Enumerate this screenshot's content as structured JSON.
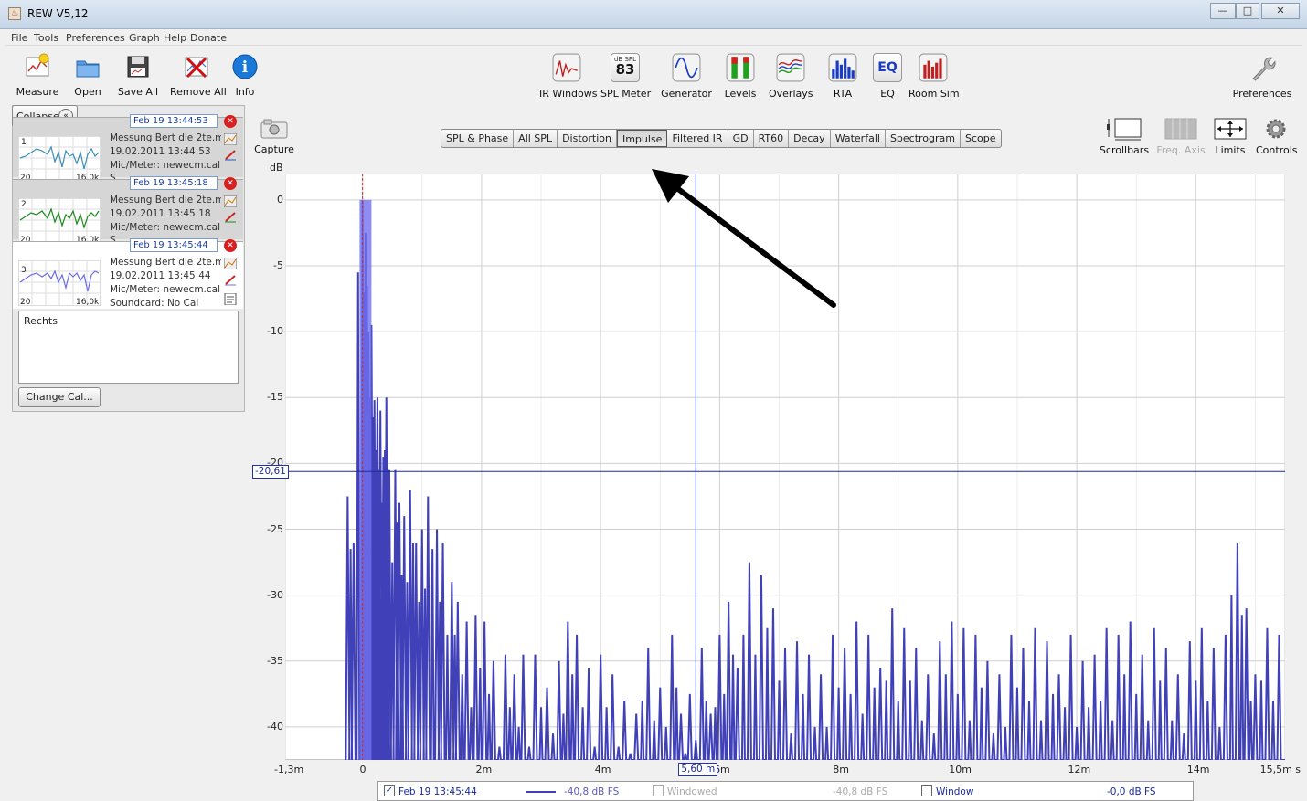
{
  "window": {
    "title": "REW V5,12",
    "min": "—",
    "max": "□",
    "close": "✕"
  },
  "menu": [
    "File",
    "Tools",
    "Preferences",
    "Graph",
    "Help",
    "Donate"
  ],
  "toolbar_left": [
    {
      "label": "Measure",
      "icon": "measure-icon"
    },
    {
      "label": "Open",
      "icon": "folder-icon"
    },
    {
      "label": "Save All",
      "icon": "save-icon"
    },
    {
      "label": "Remove All",
      "icon": "remove-all-icon"
    },
    {
      "label": "Info",
      "icon": "info-icon"
    }
  ],
  "toolbar_center": [
    {
      "label": "IR Windows",
      "icon": "ir-windows-icon"
    },
    {
      "label": "SPL Meter",
      "icon": "spl-meter-icon",
      "badge_top": "dB SPL",
      "badge_value": "83"
    },
    {
      "label": "Generator",
      "icon": "generator-icon"
    },
    {
      "label": "Levels",
      "icon": "levels-icon"
    },
    {
      "label": "Overlays",
      "icon": "overlays-icon"
    },
    {
      "label": "RTA",
      "icon": "rta-icon"
    },
    {
      "label": "EQ",
      "icon": "eq-icon",
      "badge_value": "EQ"
    },
    {
      "label": "Room Sim",
      "icon": "room-sim-icon"
    }
  ],
  "toolbar_right": {
    "label": "Preferences",
    "icon": "wrench-icon"
  },
  "capture": {
    "label": "Capture"
  },
  "graph_controls": [
    {
      "label": "Scrollbars",
      "enabled": true
    },
    {
      "label": "Freq. Axis",
      "enabled": false
    },
    {
      "label": "Limits",
      "enabled": true
    },
    {
      "label": "Controls",
      "enabled": true
    }
  ],
  "side": {
    "collapse_label": "Collapse",
    "measurements": [
      {
        "index": "1",
        "name": "Feb 19 13:44:53",
        "desc": "Messung Bert die 2te.md",
        "date": "19.02.2011 13:44:53",
        "mic": "Mic/Meter: newecm.cal \\",
        "extra": "S",
        "f_lo": "20",
        "f_hi": "16,0k",
        "color": "#3a8fb7"
      },
      {
        "index": "2",
        "name": "Feb 19 13:45:18",
        "desc": "Messung Bert die 2te.md",
        "date": "19.02.2011 13:45:18",
        "mic": "Mic/Meter: newecm.cal \\",
        "extra": "S",
        "f_lo": "20",
        "f_hi": "16,0k",
        "color": "#1a8a1a"
      },
      {
        "index": "3",
        "name": "Feb 19 13:45:44",
        "desc": "Messung Bert die 2te.md",
        "date": "19.02.2011 13:45:44",
        "mic": "Mic/Meter: newecm.cal \\",
        "extra": "Soundcard: No Cal",
        "f_lo": "20",
        "f_hi": "16,0k",
        "color": "#6b6bf0"
      }
    ],
    "notes": "Rechts",
    "change_cal": "Change Cal..."
  },
  "tabs": [
    {
      "label": "SPL & Phase",
      "selected": false
    },
    {
      "label": "All SPL",
      "selected": false
    },
    {
      "label": "Distortion",
      "selected": false
    },
    {
      "label": "Impulse",
      "selected": true
    },
    {
      "label": "Filtered IR",
      "selected": false
    },
    {
      "label": "GD",
      "selected": false
    },
    {
      "label": "RT60",
      "selected": false
    },
    {
      "label": "Decay",
      "selected": false
    },
    {
      "label": "Waterfall",
      "selected": false
    },
    {
      "label": "Spectrogram",
      "selected": false
    },
    {
      "label": "Scope",
      "selected": false
    }
  ],
  "legend": {
    "entries": [
      {
        "checked": true,
        "label": "Feb 19 13:45:44",
        "value": "-40,8 dB FS",
        "enabled": true
      },
      {
        "checked": false,
        "label": "Windowed",
        "value": "-40,8 dB FS",
        "enabled": false
      },
      {
        "checked": false,
        "label": "Window",
        "value": "-0,0 dB FS",
        "enabled": true
      }
    ]
  },
  "chart_data": {
    "type": "line",
    "ylabel": "dB",
    "xlim": [
      -1.3,
      15.5
    ],
    "ylim": [
      -42.5,
      2
    ],
    "x_ticks": [
      {
        "value": -1.3,
        "label": "-1,3m"
      },
      {
        "value": 0,
        "label": "0"
      },
      {
        "value": 2,
        "label": "2m"
      },
      {
        "value": 4,
        "label": "4m"
      },
      {
        "value": 6,
        "label": "6m"
      },
      {
        "value": 8,
        "label": "8m"
      },
      {
        "value": 10,
        "label": "10m"
      },
      {
        "value": 12,
        "label": "12m"
      },
      {
        "value": 14,
        "label": "14m"
      },
      {
        "value": 15.5,
        "label": "15,5m s"
      }
    ],
    "y_ticks": [
      {
        "value": 0,
        "label": "0"
      },
      {
        "value": -5,
        "label": "-5"
      },
      {
        "value": -10,
        "label": "-10"
      },
      {
        "value": -15,
        "label": "-15"
      },
      {
        "value": -20,
        "label": "-20"
      },
      {
        "value": -25,
        "label": "-25"
      },
      {
        "value": -30,
        "label": "-30"
      },
      {
        "value": -35,
        "label": "-35"
      },
      {
        "value": -40,
        "label": "-40"
      }
    ],
    "cursor": {
      "x": 5.6,
      "y": -20.61,
      "x_label": "5,60 m",
      "y_label": "-20,61"
    },
    "peak_marker_x": 0,
    "grid": true,
    "series": [
      {
        "name": "Feb 19 13:45:44",
        "color": "#4040b8",
        "peaks": [
          [
            -0.25,
            -22.5
          ],
          [
            -0.15,
            -26
          ],
          [
            0.0,
            0
          ],
          [
            0.05,
            -2.5
          ],
          [
            0.1,
            -10
          ],
          [
            0.15,
            -9.5
          ],
          [
            0.2,
            -15.2
          ],
          [
            0.25,
            -15
          ],
          [
            0.3,
            -16
          ],
          [
            0.35,
            -19.5
          ],
          [
            0.4,
            -15
          ],
          [
            0.45,
            -20.5
          ],
          [
            0.55,
            -20.5
          ],
          [
            0.62,
            -23
          ],
          [
            0.7,
            -24
          ],
          [
            0.8,
            -22
          ],
          [
            0.9,
            -26
          ],
          [
            1.0,
            -25
          ],
          [
            1.1,
            -22.5
          ],
          [
            1.25,
            -25
          ],
          [
            1.35,
            -26
          ],
          [
            1.5,
            -29
          ],
          [
            1.6,
            -30.5
          ],
          [
            1.75,
            -32
          ],
          [
            1.9,
            -31.5
          ],
          [
            2.05,
            -32
          ],
          [
            2.2,
            -35
          ],
          [
            2.4,
            -34.5
          ],
          [
            2.55,
            -36
          ],
          [
            2.7,
            -34.5
          ],
          [
            2.9,
            -34.5
          ],
          [
            3.1,
            -37
          ],
          [
            3.3,
            -35
          ],
          [
            3.45,
            -32
          ],
          [
            3.6,
            -33
          ],
          [
            3.8,
            -35.5
          ],
          [
            4.0,
            -34.5
          ],
          [
            4.2,
            -36
          ],
          [
            4.4,
            -38
          ],
          [
            4.6,
            -39
          ],
          [
            4.8,
            -34
          ],
          [
            5.0,
            -37
          ],
          [
            5.2,
            -33
          ],
          [
            5.35,
            -39
          ],
          [
            5.5,
            -37.5
          ],
          [
            5.7,
            -34
          ],
          [
            5.85,
            -39
          ],
          [
            6.0,
            -33
          ],
          [
            6.15,
            -30.5
          ],
          [
            6.3,
            -35.5
          ],
          [
            6.5,
            -27.5
          ],
          [
            6.7,
            -28.5
          ],
          [
            6.9,
            -31
          ],
          [
            7.1,
            -34
          ],
          [
            7.3,
            -33.5
          ],
          [
            7.5,
            -34.5
          ],
          [
            7.7,
            -36
          ],
          [
            7.9,
            -33
          ],
          [
            8.1,
            -34
          ],
          [
            8.3,
            -32
          ],
          [
            8.5,
            -33
          ],
          [
            8.7,
            -35.5
          ],
          [
            8.9,
            -31
          ],
          [
            9.1,
            -32.5
          ],
          [
            9.3,
            -34
          ],
          [
            9.5,
            -36
          ],
          [
            9.7,
            -33.5
          ],
          [
            9.9,
            -32
          ],
          [
            10.1,
            -32.5
          ],
          [
            10.3,
            -33
          ],
          [
            10.5,
            -35
          ],
          [
            10.7,
            -36
          ],
          [
            10.9,
            -33
          ],
          [
            11.1,
            -34
          ],
          [
            11.3,
            -32.5
          ],
          [
            11.5,
            -33.5
          ],
          [
            11.7,
            -36
          ],
          [
            11.9,
            -33
          ],
          [
            12.1,
            -35
          ],
          [
            12.3,
            -34.5
          ],
          [
            12.5,
            -32.5
          ],
          [
            12.7,
            -33
          ],
          [
            12.9,
            -32
          ],
          [
            13.1,
            -34.5
          ],
          [
            13.3,
            -32.5
          ],
          [
            13.5,
            -34
          ],
          [
            13.7,
            -36
          ],
          [
            13.9,
            -33.5
          ],
          [
            14.1,
            -32.5
          ],
          [
            14.3,
            -34
          ],
          [
            14.5,
            -33
          ],
          [
            14.7,
            -26
          ],
          [
            14.85,
            -31
          ],
          [
            15.0,
            -36
          ],
          [
            15.2,
            -32.5
          ],
          [
            15.4,
            -33
          ]
        ]
      }
    ]
  }
}
